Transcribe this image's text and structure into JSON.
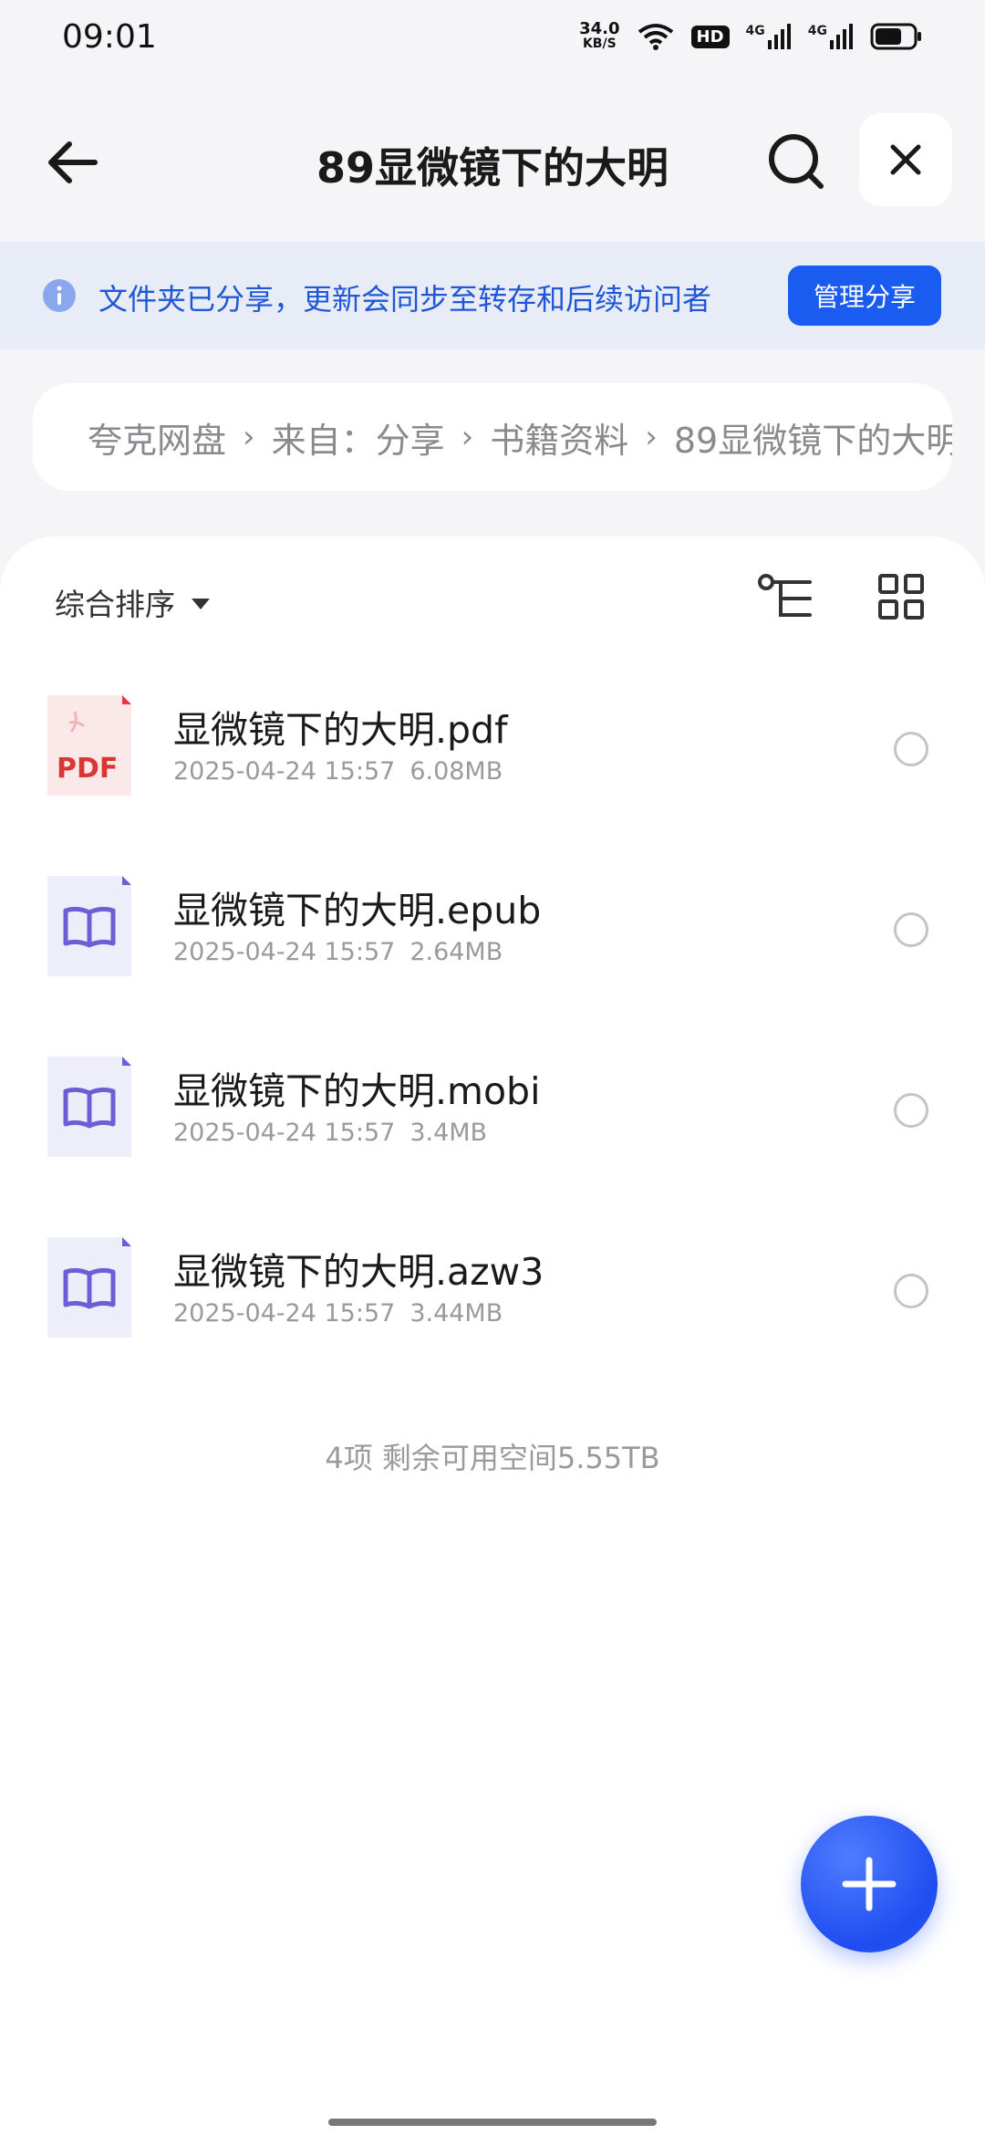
{
  "status_bar": {
    "time": "09:01",
    "net_speed_value": "34.0",
    "net_speed_unit": "KB/S",
    "hd_badge": "HD",
    "signal1_label": "4G",
    "signal2_label": "4G",
    "battery_level": 0.7
  },
  "header": {
    "title": "89显微镜下的大明",
    "back_icon": "arrow-left-icon",
    "search_icon": "search-icon",
    "close_icon": "close-icon"
  },
  "share_banner": {
    "text": "文件夹已分享，更新会同步至转存和后续访问者",
    "button_label": "管理分享",
    "accent": "#1a5cf0"
  },
  "breadcrumb": {
    "items": [
      "夸克网盘",
      "来自：分享",
      "书籍资料",
      "89显微镜下的大明"
    ]
  },
  "toolbar": {
    "sort_label": "综合排序",
    "tree_icon": "tree-view-icon",
    "grid_icon": "grid-view-icon"
  },
  "files": [
    {
      "name": "显微镜下的大明.pdf",
      "date": "2025-04-24 15:57",
      "size": "6.08MB",
      "type": "pdf",
      "type_label": "PDF"
    },
    {
      "name": "显微镜下的大明.epub",
      "date": "2025-04-24 15:57",
      "size": "2.64MB",
      "type": "book"
    },
    {
      "name": "显微镜下的大明.mobi",
      "date": "2025-04-24 15:57",
      "size": "3.4MB",
      "type": "book"
    },
    {
      "name": "显微镜下的大明.azw3",
      "date": "2025-04-24 15:57",
      "size": "3.44MB",
      "type": "book"
    }
  ],
  "summary": "4项 剩余可用空间5.55TB",
  "fab_icon": "plus-icon"
}
